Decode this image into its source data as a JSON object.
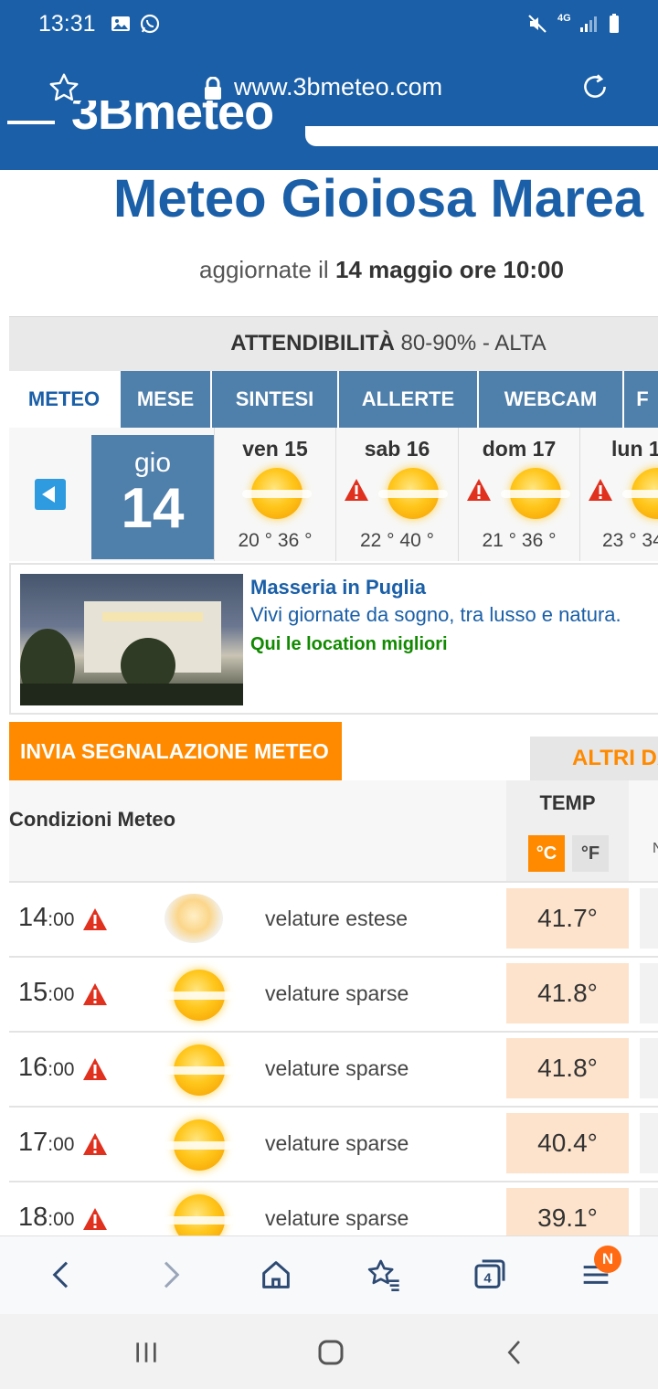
{
  "status_bar": {
    "time": "13:31",
    "network": "4G"
  },
  "browser": {
    "url": "www.3bmeteo.com"
  },
  "site": {
    "logo": "3Bmeteo"
  },
  "header": {
    "title": "Meteo Gioiosa Marea",
    "updated_prefix": "aggiornate il ",
    "updated_value": "14 maggio ore 10:00"
  },
  "reliability": {
    "label": "ATTENDIBILITÀ",
    "value": "80-90% - ALTA"
  },
  "tabs": [
    {
      "label": "METEO",
      "active": true
    },
    {
      "label": "MESE"
    },
    {
      "label": "SINTESI"
    },
    {
      "label": "ALLERTE"
    },
    {
      "label": "WEBCAM"
    },
    {
      "label": "F"
    }
  ],
  "days": {
    "today": {
      "name": "gio",
      "number": "14"
    },
    "list": [
      {
        "label": "ven 15",
        "range": "20 ° 36 °",
        "alert": false
      },
      {
        "label": "sab 16",
        "range": "22 ° 40 °",
        "alert": true
      },
      {
        "label": "dom 17",
        "range": "21 ° 36 °",
        "alert": true
      },
      {
        "label": "lun 1",
        "range": "23 ° 34",
        "alert": true
      }
    ]
  },
  "ad": {
    "title": "Masseria in Puglia",
    "description": "Vivi giornate da sogno, tra lusso e natura.",
    "cta": "Qui le location migliori"
  },
  "report_button": "INVIA SEGNALAZIONE METEO",
  "other_data_tab": "ALTRI DA",
  "table": {
    "conditions_label": "Condizioni Meteo",
    "temp_label": "TEMP",
    "unit_c": "°C",
    "unit_f": "°F",
    "next_col_peek": "N",
    "rows": [
      {
        "hour": "14",
        "min": ":00",
        "desc": "velature estese",
        "temp": "41.7°"
      },
      {
        "hour": "15",
        "min": ":00",
        "desc": "velature sparse",
        "temp": "41.8°"
      },
      {
        "hour": "16",
        "min": ":00",
        "desc": "velature sparse",
        "temp": "41.8°"
      },
      {
        "hour": "17",
        "min": ":00",
        "desc": "velature sparse",
        "temp": "40.4°"
      },
      {
        "hour": "18",
        "min": ":00",
        "desc": "velature sparse",
        "temp": "39.1°"
      }
    ]
  },
  "bottom_bar": {
    "tabs_count": "4",
    "menu_badge": "N"
  },
  "colors": {
    "brand_blue": "#1a5fa7",
    "tab_blue": "#4f7fab",
    "orange": "#ff8a00",
    "alert_red": "#e0301e"
  }
}
